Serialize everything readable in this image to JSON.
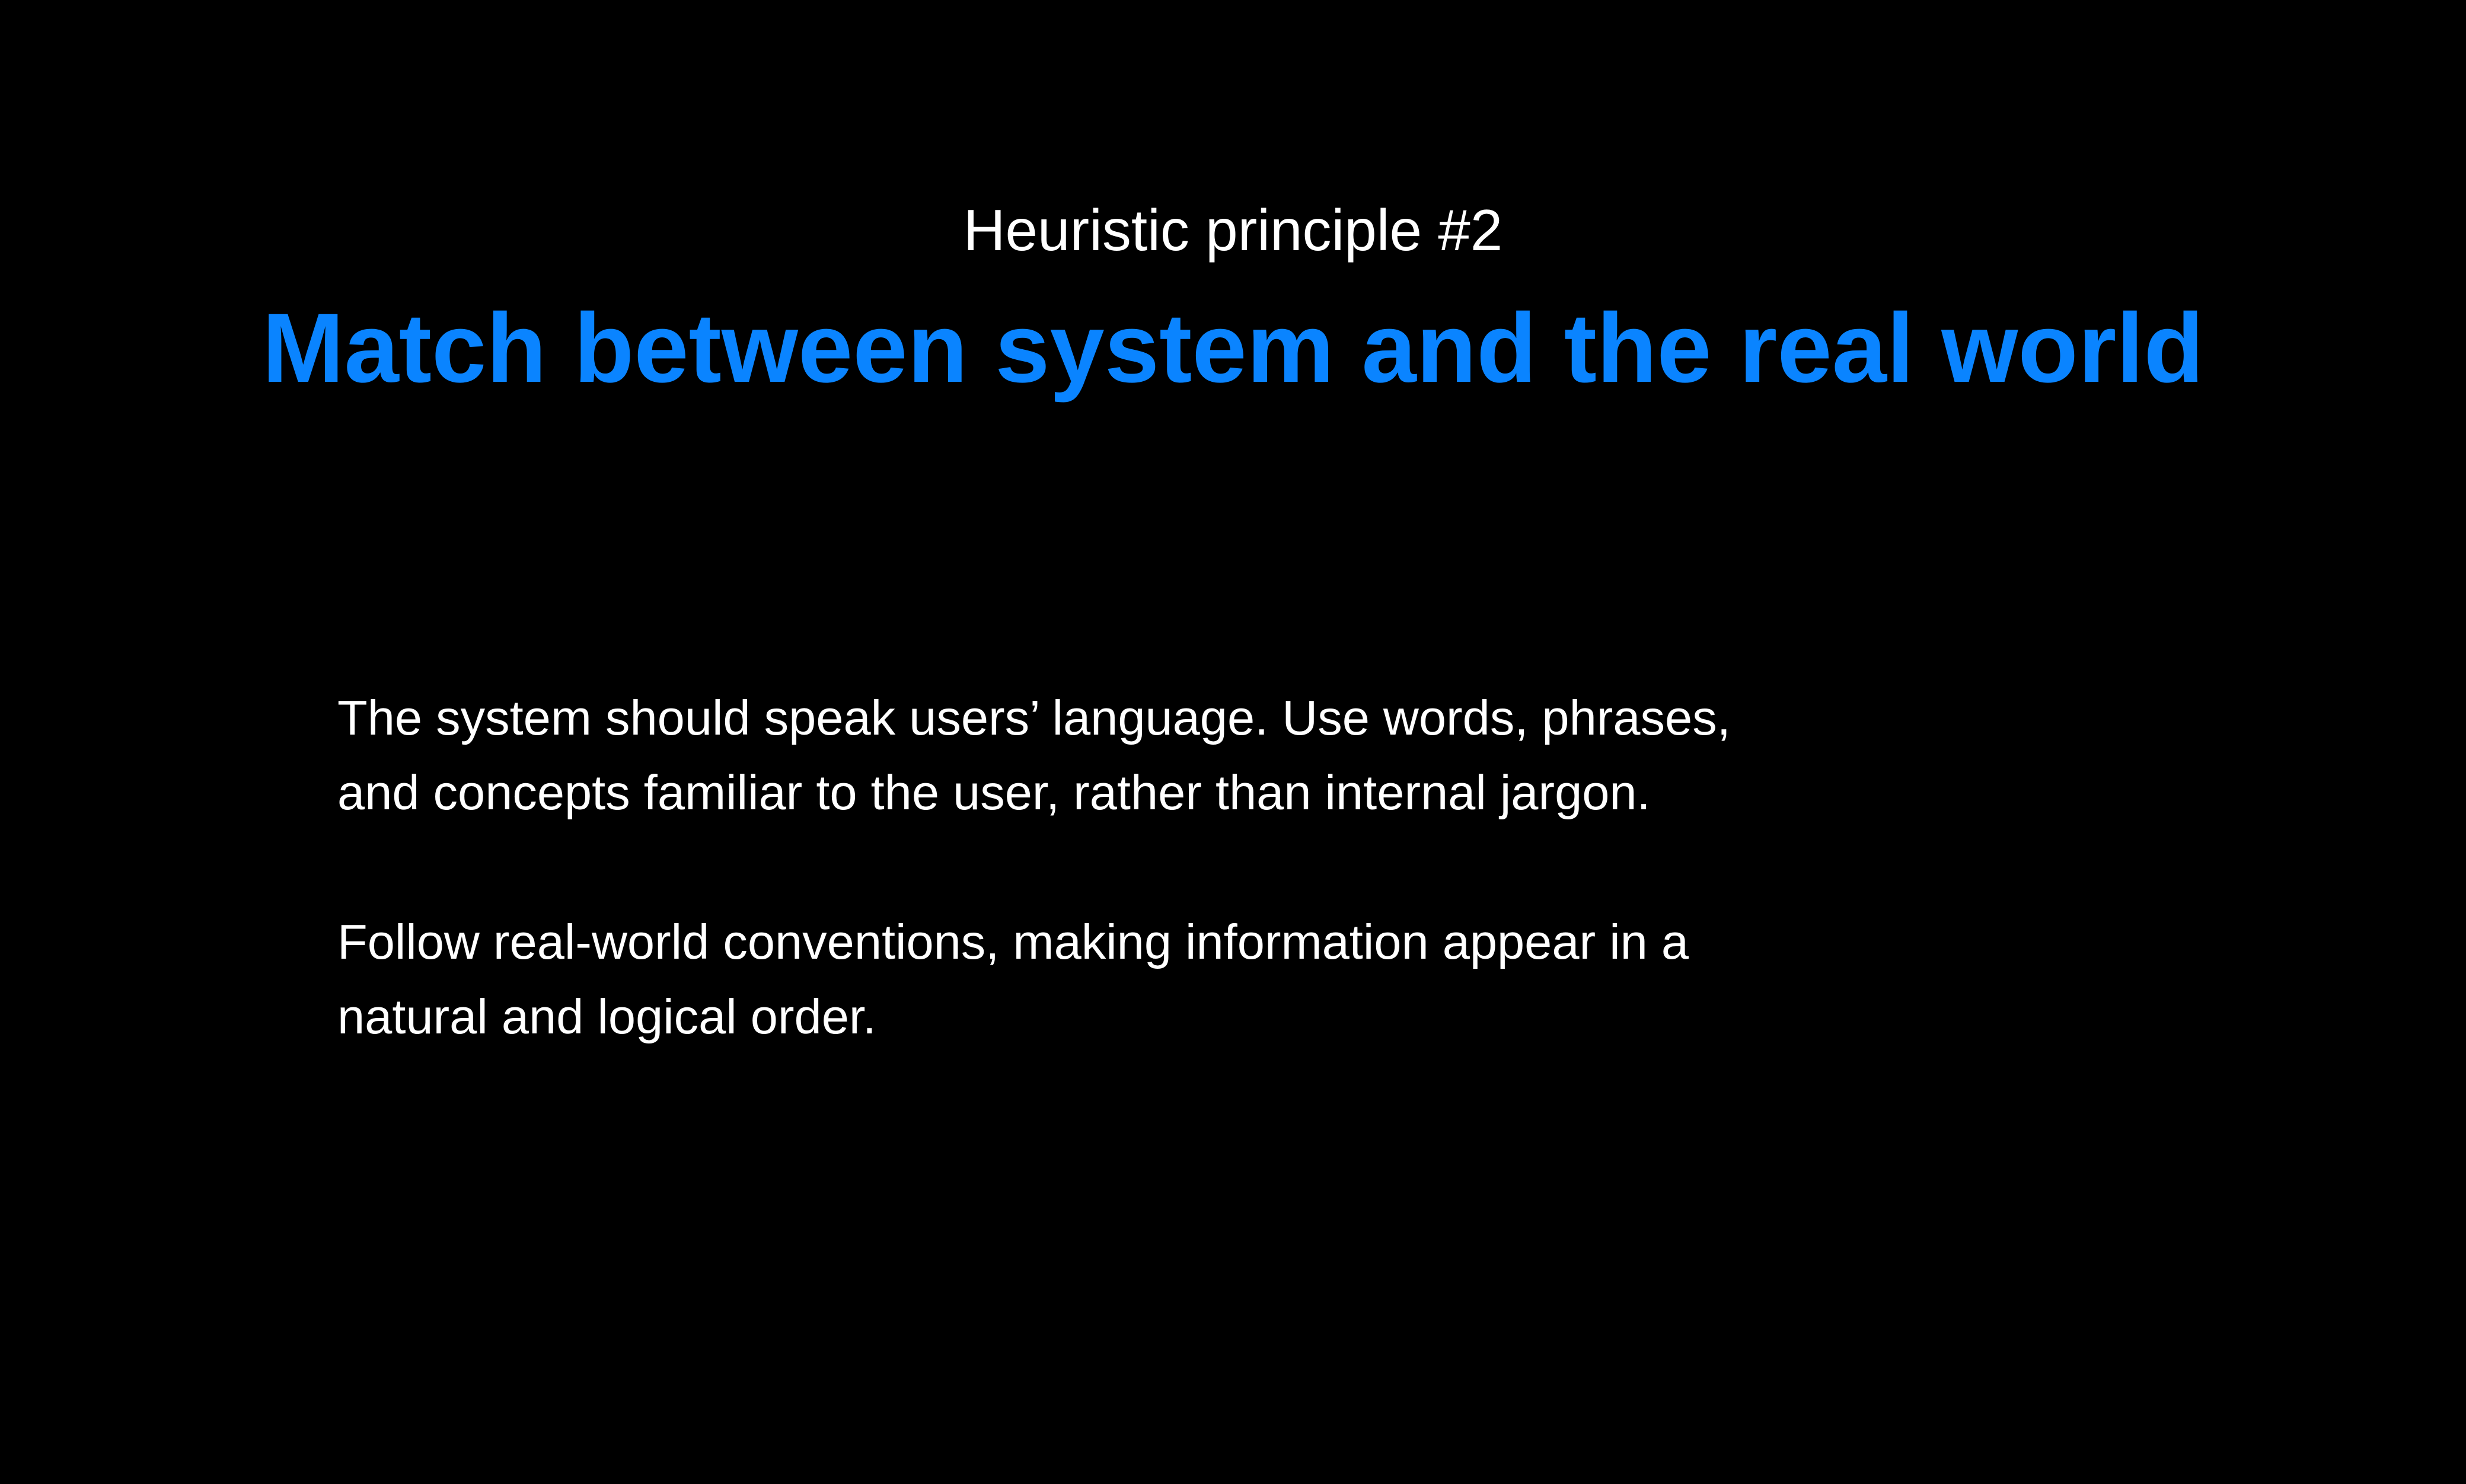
{
  "slide": {
    "eyebrow": "Heuristic principle #2",
    "title": "Match between system and the real world",
    "paragraphs": [
      "The system should speak users’ language. Use words, phrases, and concepts familiar to the user, rather than internal jargon.",
      "Follow real-world conventions, making information appear in a natural and logical order."
    ]
  },
  "colors": {
    "background": "#000000",
    "title": "#0a84ff",
    "text": "#ffffff"
  }
}
